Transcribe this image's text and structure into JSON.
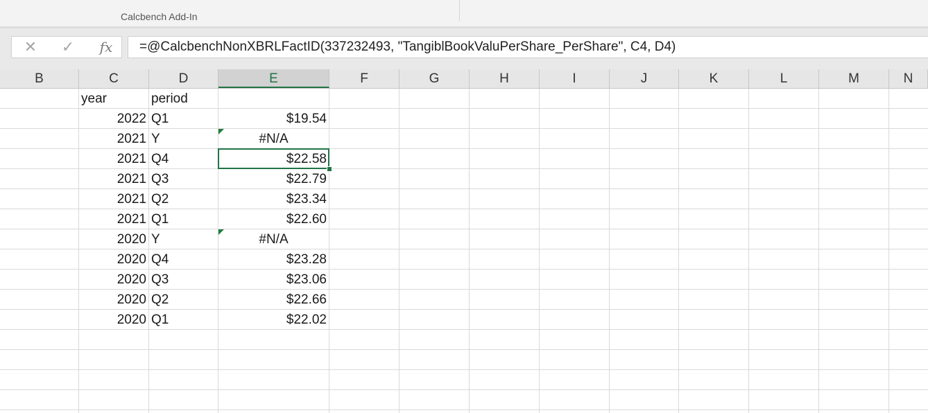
{
  "ribbon": {
    "group_label": "Calcbench Add-In"
  },
  "formula_bar": {
    "cancel_glyph": "✕",
    "enter_glyph": "✓",
    "fx_label": "fx",
    "formula": "=@CalcbenchNonXBRLFactID(337232493, \"TangiblBookValuPerShare_PerShare\", C4, D4)"
  },
  "columns": [
    "B",
    "C",
    "D",
    "E",
    "F",
    "G",
    "H",
    "I",
    "J",
    "K",
    "L",
    "M",
    "N"
  ],
  "selected_column": "E",
  "sheet": {
    "headers": {
      "year": "year",
      "period": "period"
    },
    "rows": [
      {
        "year": "2022",
        "period": "Q1",
        "value": "$19.54",
        "error": false
      },
      {
        "year": "2021",
        "period": "Y",
        "value": "#N/A",
        "error": true
      },
      {
        "year": "2021",
        "period": "Q4",
        "value": "$22.58",
        "error": false,
        "active": true
      },
      {
        "year": "2021",
        "period": "Q3",
        "value": "$22.79",
        "error": false
      },
      {
        "year": "2021",
        "period": "Q2",
        "value": "$23.34",
        "error": false
      },
      {
        "year": "2021",
        "period": "Q1",
        "value": "$22.60",
        "error": false
      },
      {
        "year": "2020",
        "period": "Y",
        "value": "#N/A",
        "error": true
      },
      {
        "year": "2020",
        "period": "Q4",
        "value": "$23.28",
        "error": false
      },
      {
        "year": "2020",
        "period": "Q3",
        "value": "$23.06",
        "error": false
      },
      {
        "year": "2020",
        "period": "Q2",
        "value": "$22.66",
        "error": false
      },
      {
        "year": "2020",
        "period": "Q1",
        "value": "$22.02",
        "error": false
      }
    ]
  },
  "colors": {
    "accent": "#217346",
    "error_indicator": "#1e7d3c"
  }
}
